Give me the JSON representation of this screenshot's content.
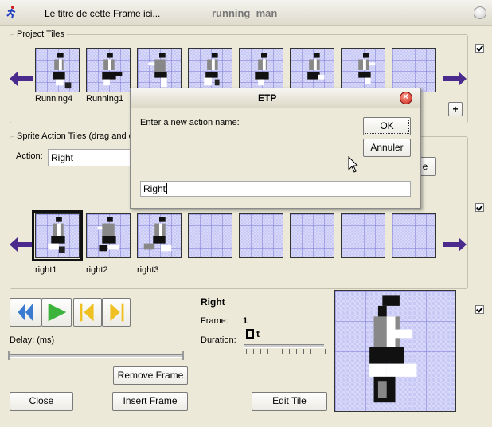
{
  "window": {
    "title_left": "Le titre de cette Frame ici...",
    "title_center": "running_man"
  },
  "project_tiles": {
    "label": "Project Tiles",
    "tiles": [
      "Running4",
      "Running1",
      "",
      "",
      "",
      "",
      "",
      ""
    ],
    "plus": "+"
  },
  "sprite_action": {
    "label": "Sprite Action Tiles (drag and d",
    "action_label": "Action:",
    "action_value": "Right",
    "hidden_button_tail": "e",
    "tiles": [
      "right1",
      "right2",
      "right3",
      "",
      "",
      "",
      "",
      ""
    ]
  },
  "playback": {
    "delay_label": "Delay: (ms)"
  },
  "frame_info": {
    "name": "Right",
    "frame_label": "Frame:",
    "frame_value": "1",
    "duration_label": "Duration:",
    "duration_glyph": "t"
  },
  "buttons": {
    "remove_frame": "Remove Frame",
    "close": "Close",
    "insert_frame": "Insert Frame",
    "edit_tile": "Edit Tile"
  },
  "dialog": {
    "title": "ETP",
    "prompt": "Enter a new action name:",
    "ok": "OK",
    "cancel": "Annuler",
    "input_value": "Right"
  },
  "colors": {
    "arrow": "#4a2a8c",
    "tile_bg": "#c8c8f4",
    "play_green": "#3cb43c",
    "step_gold": "#f0c020",
    "rewind_blue": "#3a7ad0"
  }
}
